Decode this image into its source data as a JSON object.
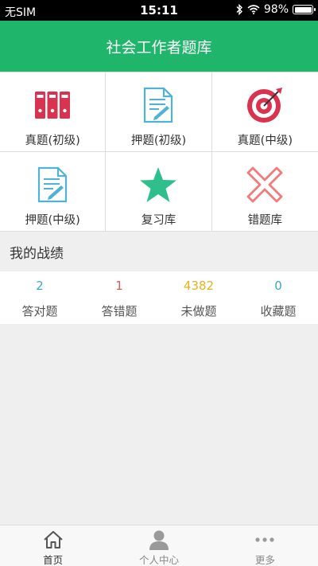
{
  "status_bar": {
    "carrier": "无SIM",
    "time": "15:11",
    "battery": "98%"
  },
  "nav": {
    "title": "社会工作者题库"
  },
  "menu": [
    {
      "label": "真题(初级)",
      "icon": "binders-icon"
    },
    {
      "label": "押题(初级)",
      "icon": "document-pen-icon"
    },
    {
      "label": "真题(中级)",
      "icon": "target-icon"
    },
    {
      "label": "押题(中级)",
      "icon": "document-pen-icon"
    },
    {
      "label": "复习库",
      "icon": "star-icon"
    },
    {
      "label": "错题库",
      "icon": "cross-icon"
    }
  ],
  "record": {
    "title": "我的战绩",
    "stats": [
      {
        "value": "2",
        "label": "答对题",
        "color": "#3aa6c9"
      },
      {
        "value": "1",
        "label": "答错题",
        "color": "#e05a5a"
      },
      {
        "value": "4382",
        "label": "未做题",
        "color": "#e8b21e"
      },
      {
        "value": "0",
        "label": "收藏题",
        "color": "#3aa6c9"
      }
    ]
  },
  "tabbar": [
    {
      "label": "首页",
      "icon": "home-icon",
      "active": true
    },
    {
      "label": "个人中心",
      "icon": "user-icon",
      "active": false
    },
    {
      "label": "更多",
      "icon": "more-icon",
      "active": false
    }
  ],
  "colors": {
    "brand": "#1fb56a",
    "red": "#d9334f",
    "blue": "#4fb3d9",
    "green": "#2fbf8c",
    "pink": "#ef7c7c"
  }
}
